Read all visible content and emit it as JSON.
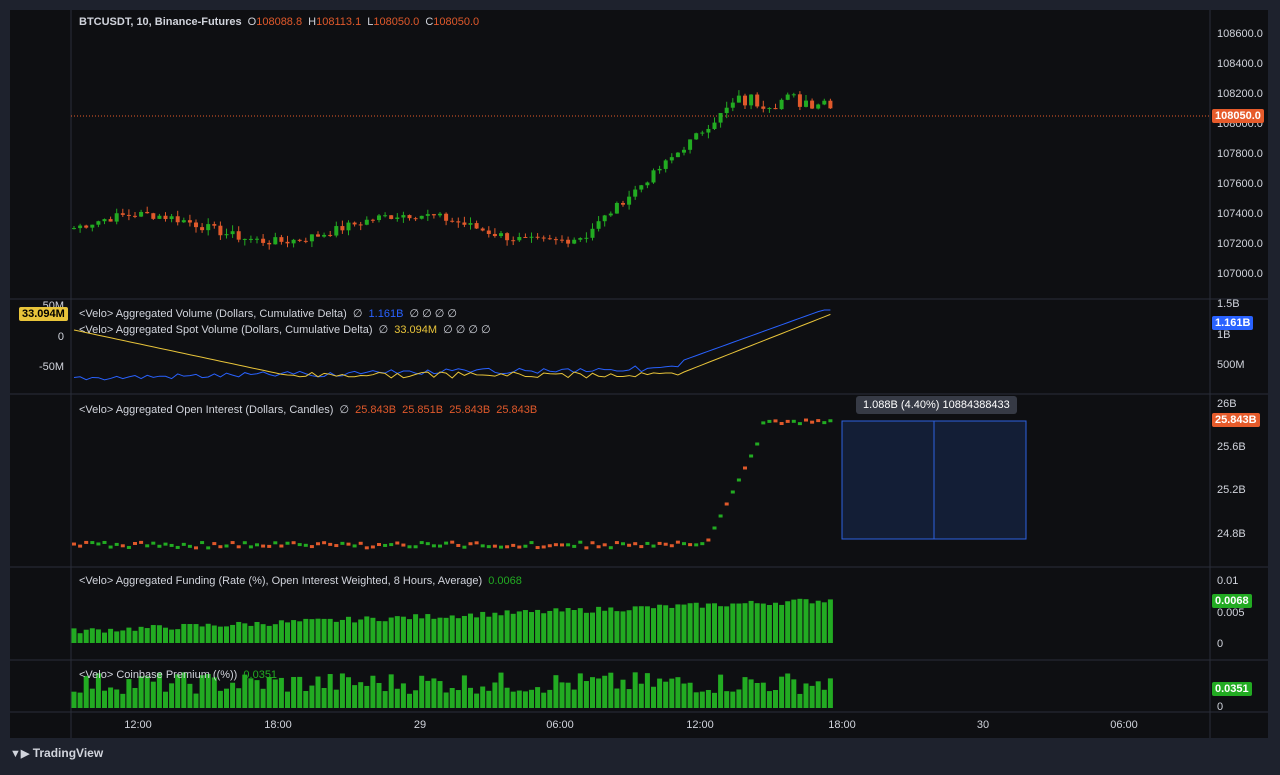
{
  "app": {
    "brand": "TradingView"
  },
  "colors": {
    "up": "#26a69a",
    "upGreen": "#22ab22",
    "down": "#e0592b",
    "price_line": "#e65b2b",
    "cum_delta": "#2962ff",
    "spot_delta": "#e8c43a",
    "measure": "#2d62e0"
  },
  "panes": {
    "price": {
      "symbol": "BTCUSDT, 10, Binance-Futures",
      "o_label": "O",
      "o": "108088.8",
      "h_label": "H",
      "h": "108113.1",
      "l_label": "L",
      "l": "108050.0",
      "c_label": "C",
      "c": "108050.0",
      "last": "108050.0",
      "scale": [
        "108600.0",
        "108400.0",
        "108200.0",
        "108000.0",
        "107800.0",
        "107600.0",
        "107400.0",
        "107200.0",
        "107000.0"
      ]
    },
    "volume": {
      "line1_name": "<Velo> Aggregated Volume (Dollars, Cumulative Delta)",
      "line1_sym": "∅",
      "line1_value": "1.161B",
      "line1_rest": "∅ ∅ ∅ ∅",
      "line2_name": "<Velo> Aggregated Spot Volume (Dollars, Cumulative Delta)",
      "line2_sym": "∅",
      "line2_value": "33.094M",
      "line2_rest": "∅ ∅ ∅ ∅",
      "left_scale": [
        "50M",
        "0",
        "-50M"
      ],
      "left_badge": "33.094M",
      "right_scale": [
        "1.5B",
        "1B",
        "500M"
      ],
      "right_badge": "1.161B"
    },
    "oi": {
      "name": "<Velo> Aggregated Open Interest (Dollars, Candles)",
      "sym": "∅",
      "v1": "25.843B",
      "v2": "25.851B",
      "v3": "25.843B",
      "v4": "25.843B",
      "scale": [
        "26B",
        "25.6B",
        "25.2B",
        "24.8B"
      ],
      "badge": "25.843B",
      "measure_label": "1.088B (4.40%) 10884388433"
    },
    "funding": {
      "name": "<Velo> Aggregated Funding (Rate (%), Open Interest Weighted, 8 Hours, Average)",
      "value": "0.0068",
      "scale": [
        "0.01",
        "0.005",
        "0"
      ],
      "badge": "0.0068"
    },
    "premium": {
      "name": "<Velo> Coinbase Premium ((%))",
      "value": "0.0351",
      "scale": [
        "0"
      ],
      "badge": "0.0351"
    }
  },
  "time_axis": [
    "12:00",
    "18:00",
    "29",
    "06:00",
    "12:00",
    "18:00",
    "30",
    "06:00"
  ]
}
